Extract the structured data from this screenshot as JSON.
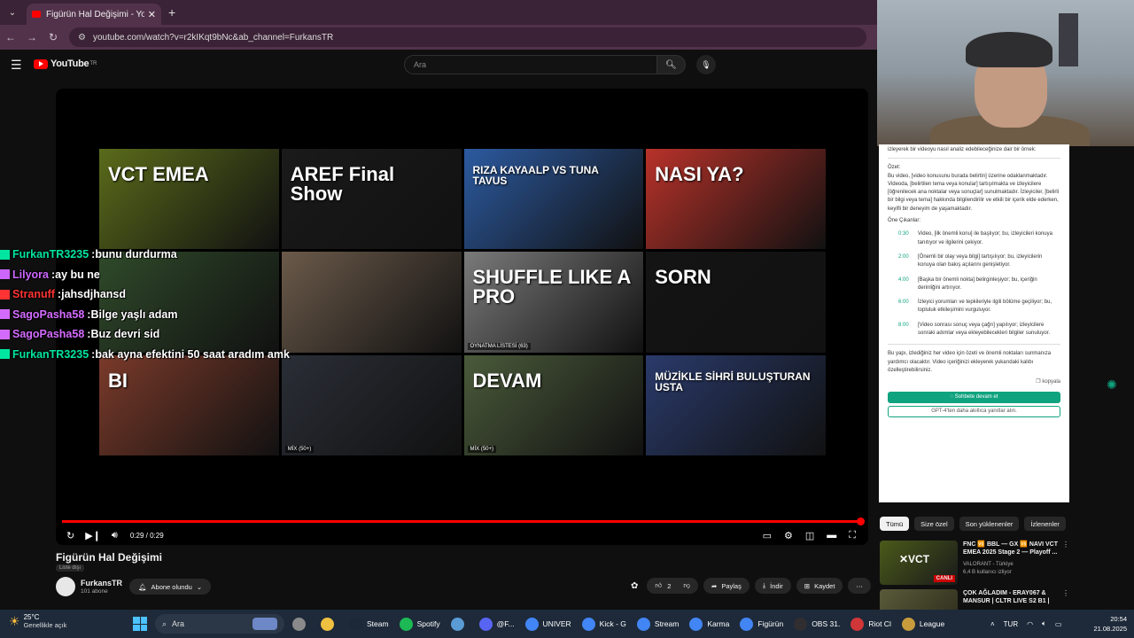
{
  "browser": {
    "tab_title": "Figürün Hal Değişimi - YouTube",
    "url": "youtube.com/watch?v=r2kIKqt9bNc&ab_channel=FurkansTR"
  },
  "youtube": {
    "logo_text": "YouTube",
    "logo_region": "TR",
    "search_placeholder": "Ara"
  },
  "end_screen": {
    "thumbs": [
      {
        "text": "VCT EMEA",
        "bg": "#5a6b1a"
      },
      {
        "text": "AREF Final Show",
        "bg": "#1a1a1a"
      },
      {
        "text": "RIZA KAYAALP VS TUNA TAVUS",
        "bg": "#2c5aa0"
      },
      {
        "text": "NASI YA?",
        "bg": "#b8322a"
      },
      {
        "text": "",
        "bg": "#2f4a2a"
      },
      {
        "text": "",
        "bg": "#6b5a4a"
      },
      {
        "text": "SHUFFLE LIKE A PRO",
        "bg": "#7a7a7a",
        "tag": "OYNATMA LİSTESİ (63)"
      },
      {
        "text": "SORN",
        "bg": "#141414"
      },
      {
        "text": "BI",
        "bg": "#7a3a2a"
      },
      {
        "text": "",
        "bg": "#2a2e36",
        "tag": "MİX (50+)"
      },
      {
        "text": "DEVAM",
        "bg": "#4a5a3a",
        "tag": "MİX (50+)"
      },
      {
        "text": "MÜZİKLE SİHRİ BULUŞTURAN USTA",
        "bg": "#2a3a6a"
      }
    ]
  },
  "player": {
    "time": "0:29 / 0:29",
    "progress_fraction": 1.0
  },
  "chat": [
    {
      "user": "FurkanTR3235",
      "msg": "bunu durdurma",
      "color": "#00e5a0"
    },
    {
      "user": "Lilyora",
      "msg": "ay bu ne",
      "color": "#cc66ff"
    },
    {
      "user": "Stranuff",
      "msg": "jahsdjhansd",
      "color": "#ff3333"
    },
    {
      "user": "SagoPasha58",
      "msg": "Bilge yaşlı adam",
      "color": "#d46bff"
    },
    {
      "user": "SagoPasha58",
      "msg": "Buz devri sid",
      "color": "#d46bff"
    },
    {
      "user": "FurkanTR3235",
      "msg": "bak ayna efektini 50 saat aradım amk",
      "color": "#00e5a0"
    }
  ],
  "video": {
    "title": "Figürün Hal Değişimi",
    "badge": "Liste dışı",
    "channel": "FurkansTR",
    "subs": "101 abone",
    "subscribe_label": "Abone olundu",
    "likes": "2",
    "share": "Paylaş",
    "download": "İndir",
    "save": "Kaydet"
  },
  "gpt": {
    "intro": "izleyerek bir videoyu nasıl analiz edebileceğinize dair bir örnek:",
    "summary_label": "Özet:",
    "summary": "Bu video, [video konusunu burada belirtin] üzerine odaklanmaktadır. Videoda, [belirtilen tema veya konular] tartışılmakta ve izleyicilere [öğrenilecek ana noktalar veya sonuçlar] sunulmaktadır. İzleyiciler, [belirli bir bilgi veya tema] hakkında bilgilendirilir ve etkili bir içerik elde ederken, keyifli bir deneyim de yaşamaktadır.",
    "highlights_label": "Öne Çıkanlar:",
    "timestamps": [
      {
        "t": "0:30",
        "text": "Video, [ilk önemli konu] ile başlıyor; bu, izleyicileri konuya tanıtıyor ve ilgilerini çekiyor."
      },
      {
        "t": "2:00",
        "text": "[Önemli bir olay veya bilgi] tartışılıyor; bu, izleyicilerin konuya olan bakış açılarını genişletiyor."
      },
      {
        "t": "4:00",
        "text": "[Başka bir önemli nokta] belirginleşiyor; bu, içeriğin derinliğini artırıyor."
      },
      {
        "t": "6:00",
        "text": "İzleyici yorumları ve tepkileriyle ilgili bölüme geçiliyor; bu, topluluk etkileşimini vurguluyor."
      },
      {
        "t": "8:00",
        "text": "[Video sonrası sonuç veya çağrı] yapılıyor; izleyicilere sonraki adımlar veya ekleyebilecekleri bilgiler sunuluyor."
      }
    ],
    "outro": "Bu yapı, izlediğiniz her video için özeti ve önemli noktaları sunmanıza yardımcı olacaktır. Video içeriğinizi ekleyerek yukarıdaki kalıbı özelleştirebilirsiniz.",
    "copy": "kopyala",
    "continue_btn": "Sohbete devam et",
    "gpt4_btn": "GPT-4'ten daha akıllıca yanıtlar alın."
  },
  "filters": [
    "Tümü",
    "Size özel",
    "Son yüklenenler",
    "İzlenenler"
  ],
  "recommendations": [
    {
      "title": "FNC 🆚 BBL — GX 🆚 NAVI VCT EMEA 2025 Stage 2 — Playoff ...",
      "channel": "VALORANT - Türkiye",
      "meta": "6,4 B kullanıcı izliyor",
      "live": "CANLI",
      "bg": "#4a5a1a"
    },
    {
      "title": "ÇOK AĞLADIM - ERAY067 & MANSUR | CLTR LIVE S2 B1 |",
      "channel": "",
      "meta": "",
      "live": "",
      "bg": "#3a3a2a"
    }
  ],
  "taskbar": {
    "temp": "25°C",
    "weather": "Genellikle açık",
    "search": "Ara",
    "apps": [
      {
        "label": "",
        "color": "#8a8a8a"
      },
      {
        "label": "",
        "color": "#f0c040"
      },
      {
        "label": "Steam",
        "color": "#1b2838"
      },
      {
        "label": "Spotify",
        "color": "#1db954"
      },
      {
        "label": "",
        "color": "#5a9bd5"
      },
      {
        "label": "@F...",
        "color": "#5865f2"
      },
      {
        "label": "UNIVER",
        "color": "#4285f4"
      },
      {
        "label": "Kick - G",
        "color": "#4285f4"
      },
      {
        "label": "Stream",
        "color": "#4285f4"
      },
      {
        "label": "Karma",
        "color": "#4285f4"
      },
      {
        "label": "Figürün",
        "color": "#4285f4"
      },
      {
        "label": "OBS 31.",
        "color": "#302e31"
      },
      {
        "label": "Riot Cl",
        "color": "#d13639"
      },
      {
        "label": "League",
        "color": "#c89b3c"
      }
    ],
    "lang": "TUR",
    "time": "20:54",
    "date": "21.08.2025"
  }
}
